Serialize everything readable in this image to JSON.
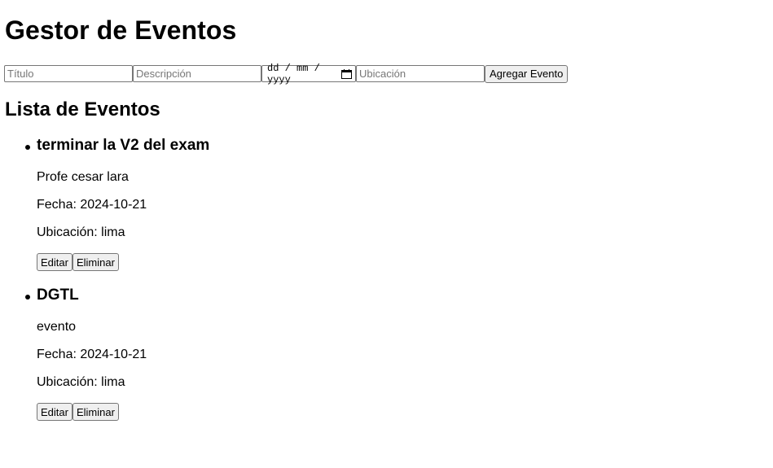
{
  "app": {
    "title": "Gestor de Eventos"
  },
  "form": {
    "title_placeholder": "Título",
    "description_placeholder": "Descripción",
    "date_placeholder": "dd / mm / yyyy",
    "location_placeholder": "Ubicación",
    "title_value": "",
    "description_value": "",
    "location_value": "",
    "submit_label": "Agregar Evento",
    "date_icon": "calendar-icon"
  },
  "list": {
    "title": "Lista de Eventos",
    "events": [
      {
        "title": "terminar la V2 del exam",
        "description": "Profe cesar lara",
        "date_line": "Fecha: 2024-10-21",
        "location_line": "Ubicación: lima",
        "edit_label": "Editar",
        "delete_label": "Eliminar"
      },
      {
        "title": "DGTL",
        "description": "evento",
        "date_line": "Fecha: 2024-10-21",
        "location_line": "Ubicación: lima",
        "edit_label": "Editar",
        "delete_label": "Eliminar"
      }
    ]
  },
  "colors": {
    "input_border": "#767676",
    "button_bg": "#efefef",
    "placeholder": "#777777"
  }
}
